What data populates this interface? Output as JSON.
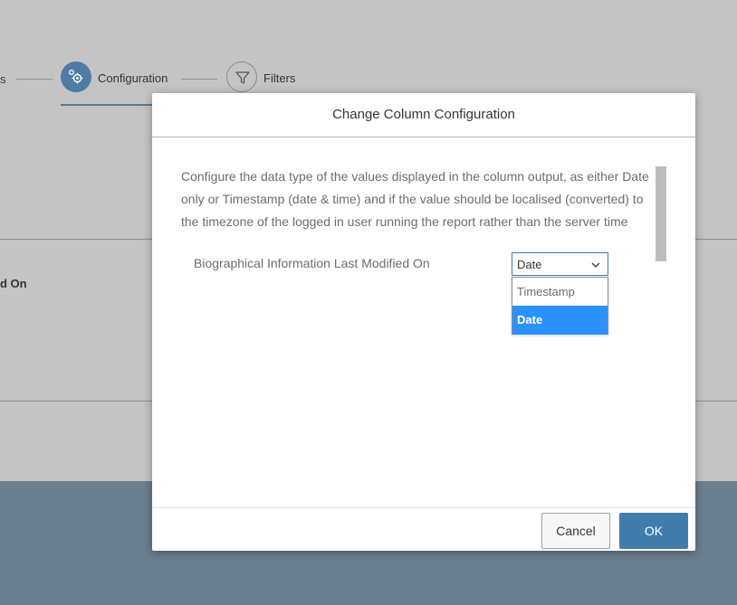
{
  "background": {
    "wizard": {
      "prev_step_fragment": "s",
      "steps": [
        {
          "label": "Configuration",
          "state": "active",
          "icon": "gear-icon"
        },
        {
          "label": "Filters",
          "state": "inactive",
          "icon": "filter-icon"
        }
      ]
    },
    "table_label_fragment": "d On"
  },
  "dialog": {
    "title": "Change Column Configuration",
    "description": "Configure the data type of the values displayed in the column output, as either Date only or Timestamp (date & time) and if the value should be localised (converted) to the timezone of the logged in user running the report rather than the server time",
    "field_label": "Biographical Information Last Modified On",
    "select": {
      "value": "Date",
      "options": [
        "Timestamp",
        "Date"
      ],
      "selected": "Date",
      "icon": "chevron-down-icon"
    },
    "buttons": {
      "cancel": "Cancel",
      "ok": "OK"
    }
  },
  "colors": {
    "accent": "#427cac",
    "selected_option": "#2b91ff",
    "overlay_bottom": "#6b7f8f"
  }
}
